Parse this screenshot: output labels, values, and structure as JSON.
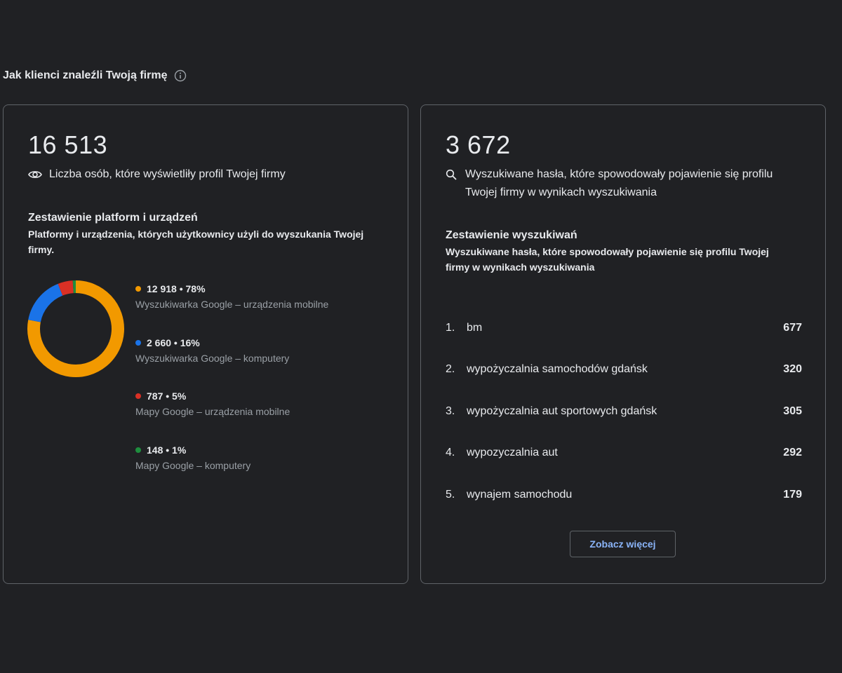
{
  "header": {
    "title": "Jak klienci znaleźli Twoją firmę",
    "info_icon": "info-icon"
  },
  "views_card": {
    "total": "16 513",
    "metric_icon": "eye-icon",
    "metric_label": "Liczba osób, które wyświetliły profil Twojej firmy",
    "breakdown_title": "Zestawienie platform i urządzeń",
    "breakdown_desc": "Platformy i urządzenia, których użytkownicy użyli do wyszukania Twojej firmy.",
    "legend": [
      {
        "value": "12 918 • 78%",
        "label": "Wyszukiwarka Google – urządzenia mobilne",
        "color": "#f29900",
        "share": 0.78
      },
      {
        "value": "2 660 • 16%",
        "label": "Wyszukiwarka Google – komputery",
        "color": "#1a73e8",
        "share": 0.16
      },
      {
        "value": "787 • 5%",
        "label": "Mapy Google – urządzenia mobilne",
        "color": "#d93025",
        "share": 0.05
      },
      {
        "value": "148 • 1%",
        "label": "Mapy Google – komputery",
        "color": "#1e8e3e",
        "share": 0.01
      }
    ]
  },
  "searches_card": {
    "total": "3 672",
    "metric_icon": "search-icon",
    "metric_label": "Wyszukiwane hasła, które spowodowały pojawienie się profilu Twojej firmy w wynikach wyszukiwania",
    "breakdown_title": "Zestawienie wyszukiwań",
    "breakdown_desc": "Wyszukiwane hasła, które spowodowały pojawienie się profilu Twojej firmy w wynikach wyszukiwania",
    "queries": [
      {
        "rank": "1.",
        "term": "bm",
        "count": "677"
      },
      {
        "rank": "2.",
        "term": "wypożyczalnia samochodów gdańsk",
        "count": "320"
      },
      {
        "rank": "3.",
        "term": "wypożyczalnia aut sportowych gdańsk",
        "count": "305"
      },
      {
        "rank": "4.",
        "term": "wypozyczalnia aut",
        "count": "292"
      },
      {
        "rank": "5.",
        "term": "wynajem samochodu",
        "count": "179"
      }
    ],
    "more_button": "Zobacz więcej"
  }
}
